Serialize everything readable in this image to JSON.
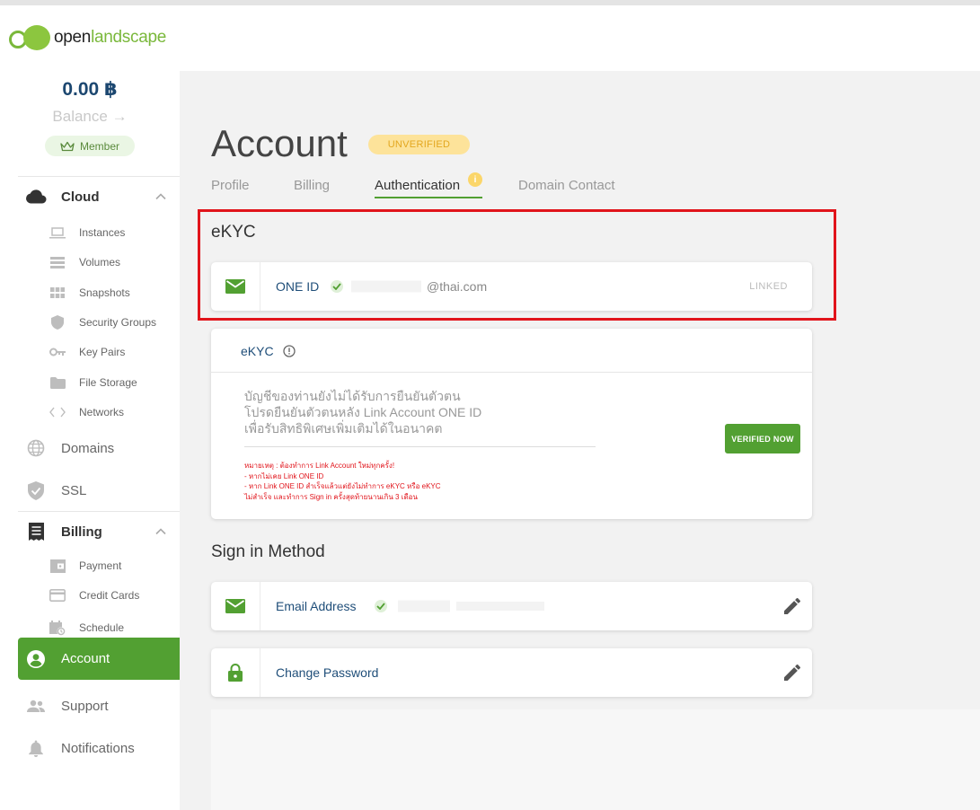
{
  "brand": {
    "logo_text_a": "open",
    "logo_text_b": "landscape"
  },
  "colors": {
    "accent": "#52a032",
    "navy": "#1f4e79",
    "warning_bg": "#fde39a",
    "warning_text": "#e3a71f",
    "alert": "#e1141b"
  },
  "sidebar": {
    "balance_amount": "0.00 ฿",
    "balance_label": "Balance →",
    "member_label": "Member",
    "cloud": {
      "label": "Cloud",
      "items": [
        {
          "label": "Instances",
          "icon": "laptop-icon"
        },
        {
          "label": "Volumes",
          "icon": "volumes-icon"
        },
        {
          "label": "Snapshots",
          "icon": "snapshots-icon"
        },
        {
          "label": "Security Groups",
          "icon": "shield-icon"
        },
        {
          "label": "Key Pairs",
          "icon": "key-icon"
        },
        {
          "label": "File Storage",
          "icon": "folder-icon"
        },
        {
          "label": "Networks",
          "icon": "code-icon"
        }
      ]
    },
    "domains_label": "Domains",
    "ssl_label": "SSL",
    "billing": {
      "label": "Billing",
      "items": [
        {
          "label": "Payment",
          "icon": "wallet-icon"
        },
        {
          "label": "Credit Cards",
          "icon": "credit-card-icon"
        },
        {
          "label": "Schedule",
          "icon": "calendar-clock-icon"
        }
      ]
    },
    "account_label": "Account",
    "support_label": "Support",
    "notifications_label": "Notifications"
  },
  "main": {
    "title": "Account",
    "status": "UNVERIFIED",
    "tabs": [
      {
        "label": "Profile"
      },
      {
        "label": "Billing"
      },
      {
        "label": "Authentication",
        "badge": "i"
      },
      {
        "label": "Domain Contact"
      }
    ],
    "ekyc_section_title": "eKYC",
    "one_id": {
      "label": "ONE ID",
      "email_domain": "@thai.com",
      "status": "LINKED"
    },
    "ekyc_card": {
      "title": "eKYC",
      "message_line1": "บัญชีของท่านยังไม่ได้รับการยืนยันตัวตน",
      "message_line2": "โปรดยืนยันตัวตนหลัง Link Account ONE ID",
      "message_line3": "เพื่อรับสิทธิพิเศษเพิ่มเติมได้ในอนาคต",
      "note_line1": "หมายเหตุ : ต้องทำการ Link Account ใหม่ทุกครั้ง!",
      "note_line2": "- หากไม่เคย Link ONE ID",
      "note_line3": "- หาก Link ONE ID สำเร็จแล้วแต่ยังไม่ทำการ eKYC หรือ eKYC",
      "note_line4": "ไม่สำเร็จ และทำการ Sign in ครั้งสุดท้ายนานเกิน 3 เดือน",
      "button_label": "VERIFIED NOW"
    },
    "sign_in_title": "Sign in Method",
    "email_row": {
      "label": "Email Address"
    },
    "password_row": {
      "label": "Change Password"
    }
  }
}
